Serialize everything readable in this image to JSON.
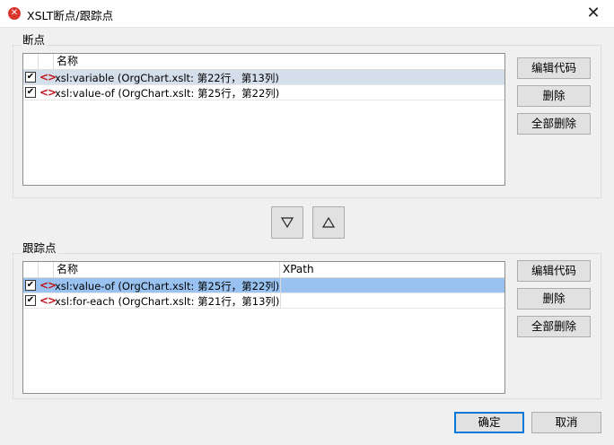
{
  "window": {
    "title": "XSLT断点/跟踪点",
    "app_icon": "xslt-app-icon",
    "close_icon": "close-icon"
  },
  "breakpoints": {
    "group_label": "断点",
    "columns": {
      "name": "名称"
    },
    "rows": [
      {
        "checked": true,
        "icon": "breakpoint-tag-icon",
        "name": "xsl:variable  (OrgChart.xslt: 第22行，第13列)",
        "selected": true
      },
      {
        "checked": true,
        "icon": "breakpoint-tag-icon",
        "name": "xsl:value-of  (OrgChart.xslt: 第25行，第22列)",
        "selected": false
      }
    ],
    "buttons": {
      "edit": "编辑代码",
      "delete": "删除",
      "delete_all": "全部删除"
    }
  },
  "move_buttons": {
    "down_icon": "triangle-down-icon",
    "up_icon": "triangle-up-icon"
  },
  "tracepoints": {
    "group_label": "跟踪点",
    "columns": {
      "name": "名称",
      "xpath": "XPath"
    },
    "rows": [
      {
        "checked": true,
        "icon": "tracepoint-tag-icon",
        "name": "xsl:value-of  (OrgChart.xslt: 第25行，第22列)",
        "xpath": "",
        "selected": true
      },
      {
        "checked": true,
        "icon": "tracepoint-tag-icon",
        "name": "xsl:for-each  (OrgChart.xslt: 第21行，第13列)",
        "xpath": "",
        "selected": false
      }
    ],
    "buttons": {
      "edit": "编辑代码",
      "delete": "删除",
      "delete_all": "全部删除"
    }
  },
  "footer": {
    "ok": "确定",
    "cancel": "取消"
  },
  "colors": {
    "selection_light": "#d5deeb",
    "selection_blue": "#99c2f0",
    "tag_red": "#c0141b",
    "default_button_border": "#0078d7"
  }
}
